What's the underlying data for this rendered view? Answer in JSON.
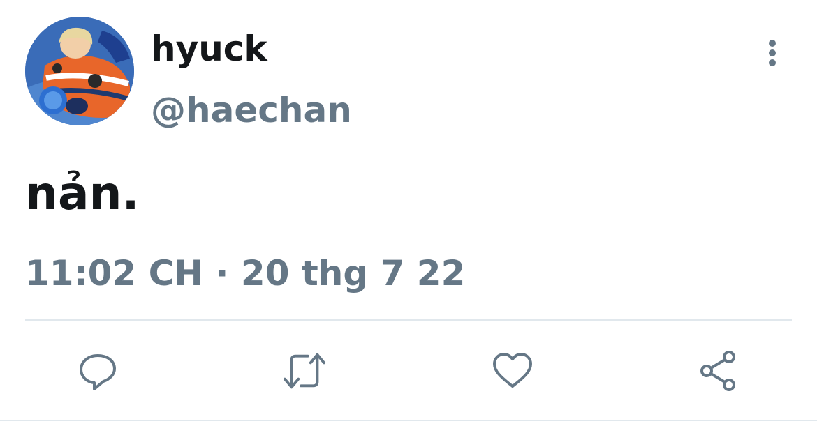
{
  "tweet": {
    "display_name": "hyuck",
    "handle": "@haechan",
    "text": "nản.",
    "timestamp": "11:02 CH · 20 thg 7 22"
  },
  "icons": {
    "avatar": "profile-photo",
    "more": "more-vertical-icon",
    "reply": "reply-icon",
    "retweet": "retweet-icon",
    "like": "heart-icon",
    "share": "share-icon"
  },
  "colors": {
    "text_primary": "#14171a",
    "text_secondary": "#657786",
    "divider": "#e1e8ed",
    "icon": "#657786"
  }
}
